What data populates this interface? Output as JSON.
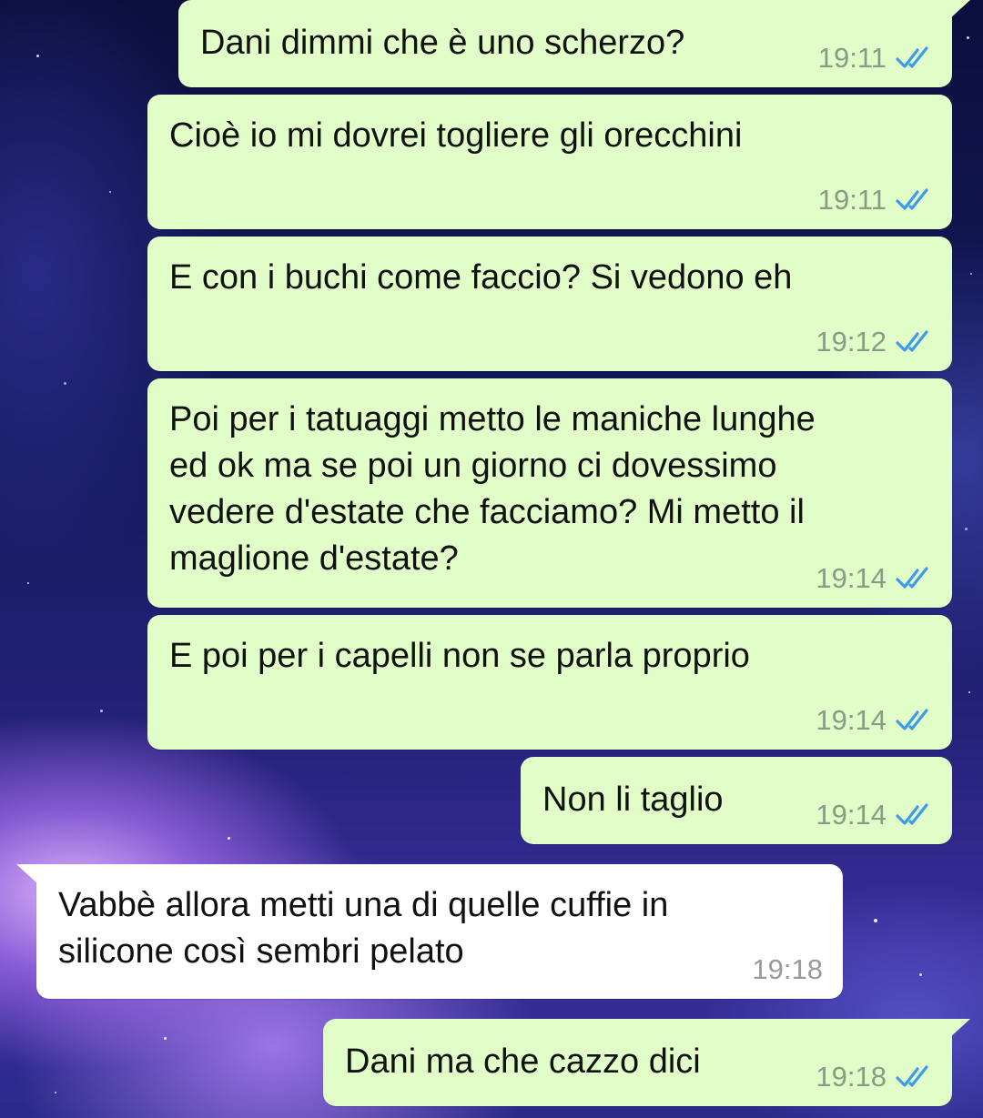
{
  "chat": {
    "messages": [
      {
        "direction": "outgoing",
        "text": "Dani dimmi che è uno scherzo?",
        "time": "19:11",
        "status_icon": "double-check-read-icon"
      },
      {
        "direction": "outgoing",
        "text": "Cioè io mi dovrei togliere gli orecchini",
        "time": "19:11",
        "status_icon": "double-check-read-icon"
      },
      {
        "direction": "outgoing",
        "text": "E con i buchi come faccio? Si vedono eh",
        "time": "19:12",
        "status_icon": "double-check-read-icon"
      },
      {
        "direction": "outgoing",
        "text": "Poi per i tatuaggi metto le maniche lunghe\ned ok ma se poi un giorno ci dovessimo\nvedere d'estate che facciamo? Mi metto il\nmaglione d'estate?",
        "time": "19:14",
        "status_icon": "double-check-read-icon"
      },
      {
        "direction": "outgoing",
        "text": "E poi per i capelli non se parla proprio",
        "time": "19:14",
        "status_icon": "double-check-read-icon"
      },
      {
        "direction": "outgoing",
        "text": "Non li taglio",
        "time": "19:14",
        "status_icon": "double-check-read-icon"
      },
      {
        "direction": "incoming",
        "text": "Vabbè allora metti una di quelle cuffie in\nsilicone così sembri pelato",
        "time": "19:18"
      },
      {
        "direction": "outgoing",
        "text": "Dani ma che cazzo dici",
        "time": "19:18",
        "status_icon": "double-check-read-icon"
      }
    ]
  },
  "colors": {
    "outgoing_bubble": "#e2fec8",
    "incoming_bubble": "#ffffff",
    "read_ticks": "#3d9be9",
    "timestamp": "#8a9a84"
  }
}
